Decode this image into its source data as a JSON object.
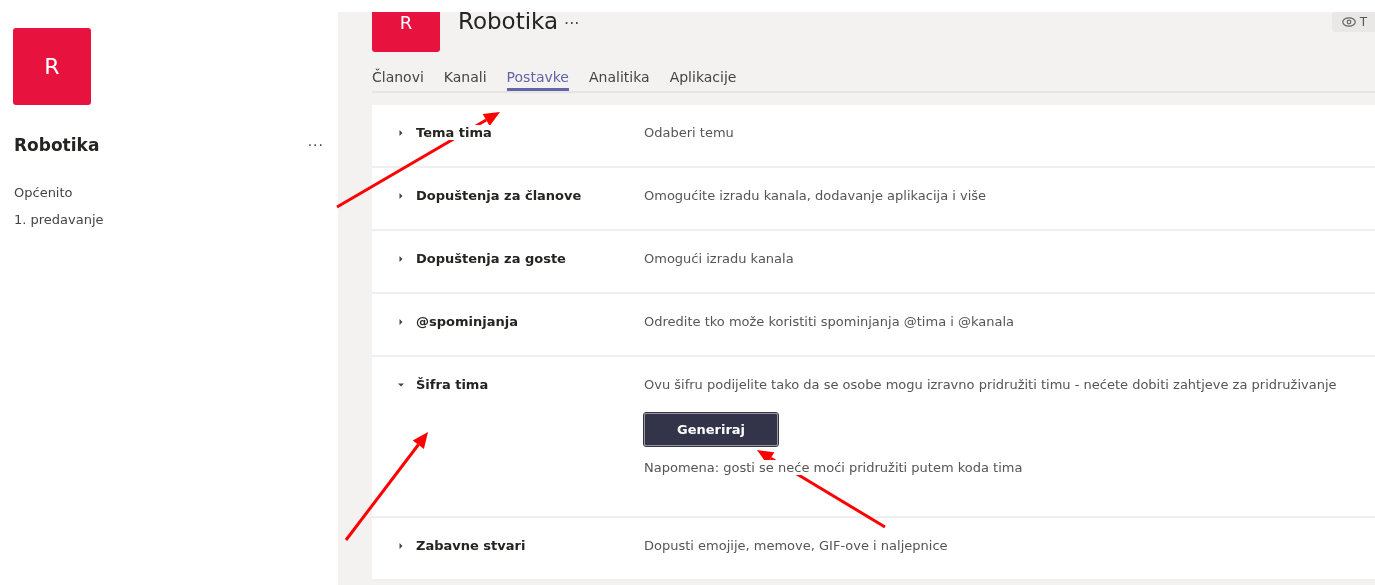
{
  "sidebar": {
    "avatar": "R",
    "team_name": "Robotika",
    "more": "···",
    "channels": [
      {
        "label": "Općenito"
      },
      {
        "label": "1. predavanje"
      }
    ]
  },
  "header": {
    "avatar": "R",
    "title": "Robotika",
    "more": "···",
    "view_button": {
      "label": "T"
    }
  },
  "tabs": [
    {
      "label": "Članovi",
      "selected": false
    },
    {
      "label": "Kanali",
      "selected": false
    },
    {
      "label": "Postavke",
      "selected": true
    },
    {
      "label": "Analitika",
      "selected": false
    },
    {
      "label": "Aplikacije",
      "selected": false
    }
  ],
  "settings": [
    {
      "title": "Tema tima",
      "description": "Odaberi temu",
      "expanded": false
    },
    {
      "title": "Dopuštenja za članove",
      "description": "Omogućite izradu kanala, dodavanje aplikacija i više",
      "expanded": false
    },
    {
      "title": "Dopuštenja za goste",
      "description": "Omogući izradu kanala",
      "expanded": false
    },
    {
      "title": "@spominjanja",
      "description": "Odredite tko može koristiti spominjanja @tima i @kanala",
      "expanded": false
    },
    {
      "title": "Šifra tima",
      "description": "Ovu šifru podijelite tako da se osobe mogu izravno pridružiti timu - nećete dobiti zahtjeve za pridruživanje",
      "expanded": true,
      "button": "Generiraj",
      "note": "Napomena: gosti se neće moći pridružiti putem koda tima"
    },
    {
      "title": "Zabavne stvari",
      "description": "Dopusti emojije, memove, GIF-ove i naljepnice",
      "expanded": false
    }
  ]
}
